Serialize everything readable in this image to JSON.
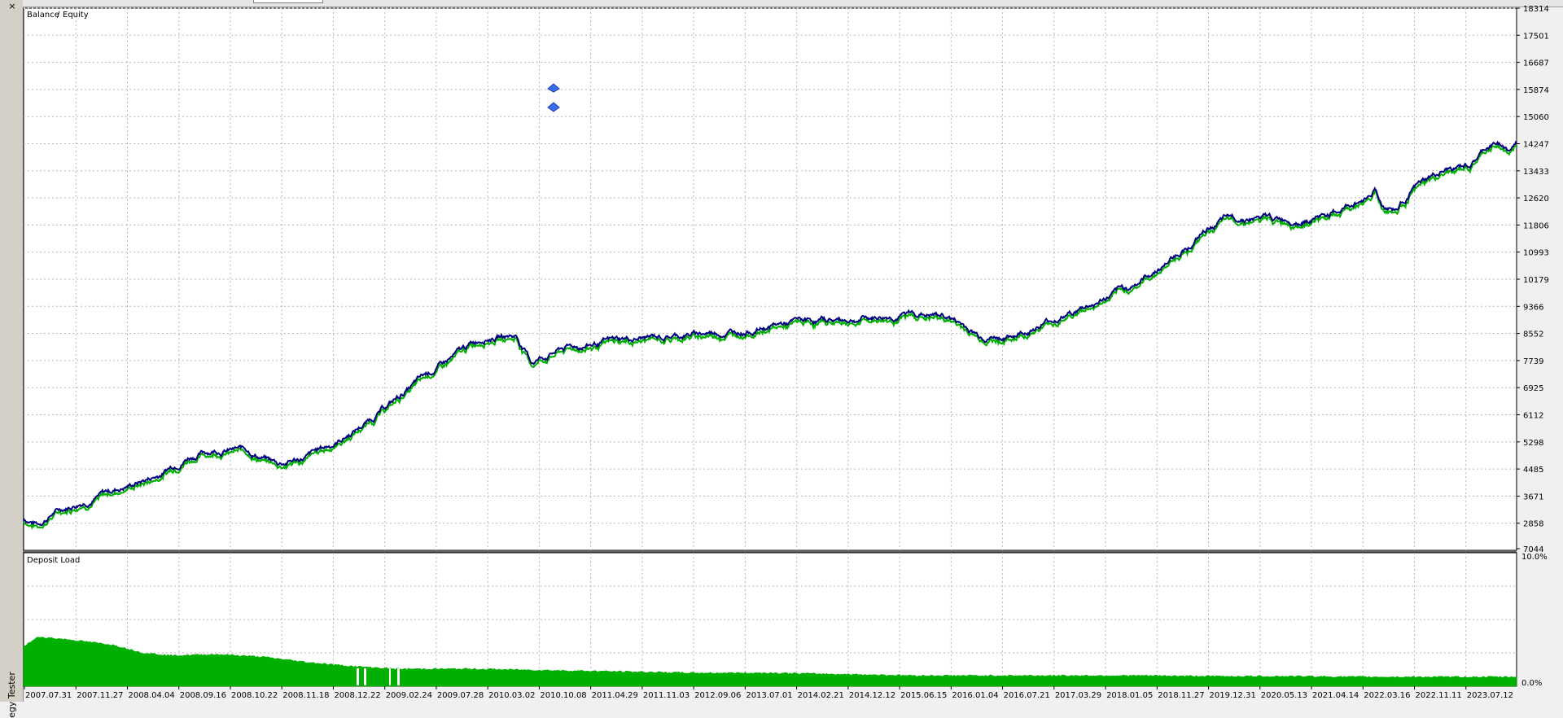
{
  "window": {
    "close_icon": "×",
    "vertical_title": "egy Tester"
  },
  "chart_data": [
    {
      "type": "line",
      "legend": [
        "Balance",
        "/",
        "Equity"
      ],
      "colors": {
        "balance": "#000080",
        "equity": "#00b000",
        "separator": "#000080"
      },
      "y_ticks": [
        7044,
        2858,
        3671,
        4485,
        5298,
        6112,
        6925,
        7739,
        8552,
        9366,
        10179,
        10993,
        11806,
        12620,
        13433,
        14247,
        15060,
        15874,
        16687,
        17501,
        18314
      ],
      "ylim": [
        2045,
        18314
      ],
      "x_ticks": [
        "2007.07.31",
        "2007.11.27",
        "2008.04.04",
        "2008.09.16",
        "2008.10.22",
        "2008.11.18",
        "2008.12.22",
        "2009.02.24",
        "2009.07.28",
        "2010.03.02",
        "2010.10.08",
        "2011.04.29",
        "2011.11.03",
        "2012.09.06",
        "2013.07.01",
        "2014.02.21",
        "2014.12.12",
        "2015.06.15",
        "2016.01.04",
        "2016.07.21",
        "2017.03.29",
        "2018.01.05",
        "2018.11.27",
        "2019.12.31",
        "2020.05.13",
        "2021.04.14",
        "2022.03.16",
        "2022.11.11",
        "2023.07.12"
      ],
      "balance_key_points": [
        [
          0,
          3000
        ],
        [
          0.01,
          2850
        ],
        [
          0.02,
          3200
        ],
        [
          0.04,
          3550
        ],
        [
          0.06,
          3850
        ],
        [
          0.09,
          4300
        ],
        [
          0.11,
          4900
        ],
        [
          0.13,
          5100
        ],
        [
          0.15,
          5050
        ],
        [
          0.16,
          4850
        ],
        [
          0.17,
          4650
        ],
        [
          0.19,
          4850
        ],
        [
          0.21,
          5300
        ],
        [
          0.23,
          5900
        ],
        [
          0.25,
          6600
        ],
        [
          0.27,
          7300
        ],
        [
          0.29,
          7900
        ],
        [
          0.31,
          8500
        ],
        [
          0.33,
          8500
        ],
        [
          0.34,
          7700
        ],
        [
          0.36,
          8100
        ],
        [
          0.4,
          8350
        ],
        [
          0.44,
          8500
        ],
        [
          0.48,
          8650
        ],
        [
          0.52,
          8900
        ],
        [
          0.56,
          9000
        ],
        [
          0.6,
          9150
        ],
        [
          0.62,
          9050
        ],
        [
          0.64,
          8500
        ],
        [
          0.66,
          8450
        ],
        [
          0.68,
          8800
        ],
        [
          0.7,
          9150
        ],
        [
          0.72,
          9500
        ],
        [
          0.74,
          9900
        ],
        [
          0.76,
          10500
        ],
        [
          0.78,
          11200
        ],
        [
          0.8,
          11900
        ],
        [
          0.82,
          12050
        ],
        [
          0.84,
          11950
        ],
        [
          0.86,
          12050
        ],
        [
          0.88,
          12200
        ],
        [
          0.9,
          12650
        ],
        [
          0.905,
          12950
        ],
        [
          0.91,
          12400
        ],
        [
          0.92,
          12300
        ],
        [
          0.93,
          12900
        ],
        [
          0.95,
          13350
        ],
        [
          0.97,
          13600
        ],
        [
          0.98,
          14100
        ],
        [
          0.99,
          14250
        ],
        [
          0.995,
          14050
        ],
        [
          1.0,
          14250
        ]
      ],
      "equity_offset": -90,
      "markers": [
        "up-arrow-marker",
        "down-arrow-marker"
      ]
    },
    {
      "type": "area",
      "title": "Deposit Load",
      "color": "#00b000",
      "y_ticks": [
        "10.0%",
        "0.0%"
      ],
      "ylim": [
        0,
        10
      ],
      "load_key_points": [
        [
          0,
          3.0
        ],
        [
          0.01,
          3.7
        ],
        [
          0.03,
          3.5
        ],
        [
          0.06,
          3.1
        ],
        [
          0.08,
          2.5
        ],
        [
          0.1,
          2.3
        ],
        [
          0.13,
          2.4
        ],
        [
          0.16,
          2.2
        ],
        [
          0.19,
          1.8
        ],
        [
          0.22,
          1.5
        ],
        [
          0.25,
          1.3
        ],
        [
          0.3,
          1.3
        ],
        [
          0.35,
          1.2
        ],
        [
          0.4,
          1.1
        ],
        [
          0.45,
          1.0
        ],
        [
          0.5,
          1.0
        ],
        [
          0.55,
          0.9
        ],
        [
          0.6,
          0.8
        ],
        [
          0.65,
          0.8
        ],
        [
          0.7,
          0.8
        ],
        [
          0.75,
          0.8
        ],
        [
          0.8,
          0.75
        ],
        [
          0.85,
          0.75
        ],
        [
          0.9,
          0.7
        ],
        [
          0.95,
          0.7
        ],
        [
          1.0,
          0.7
        ]
      ]
    }
  ]
}
